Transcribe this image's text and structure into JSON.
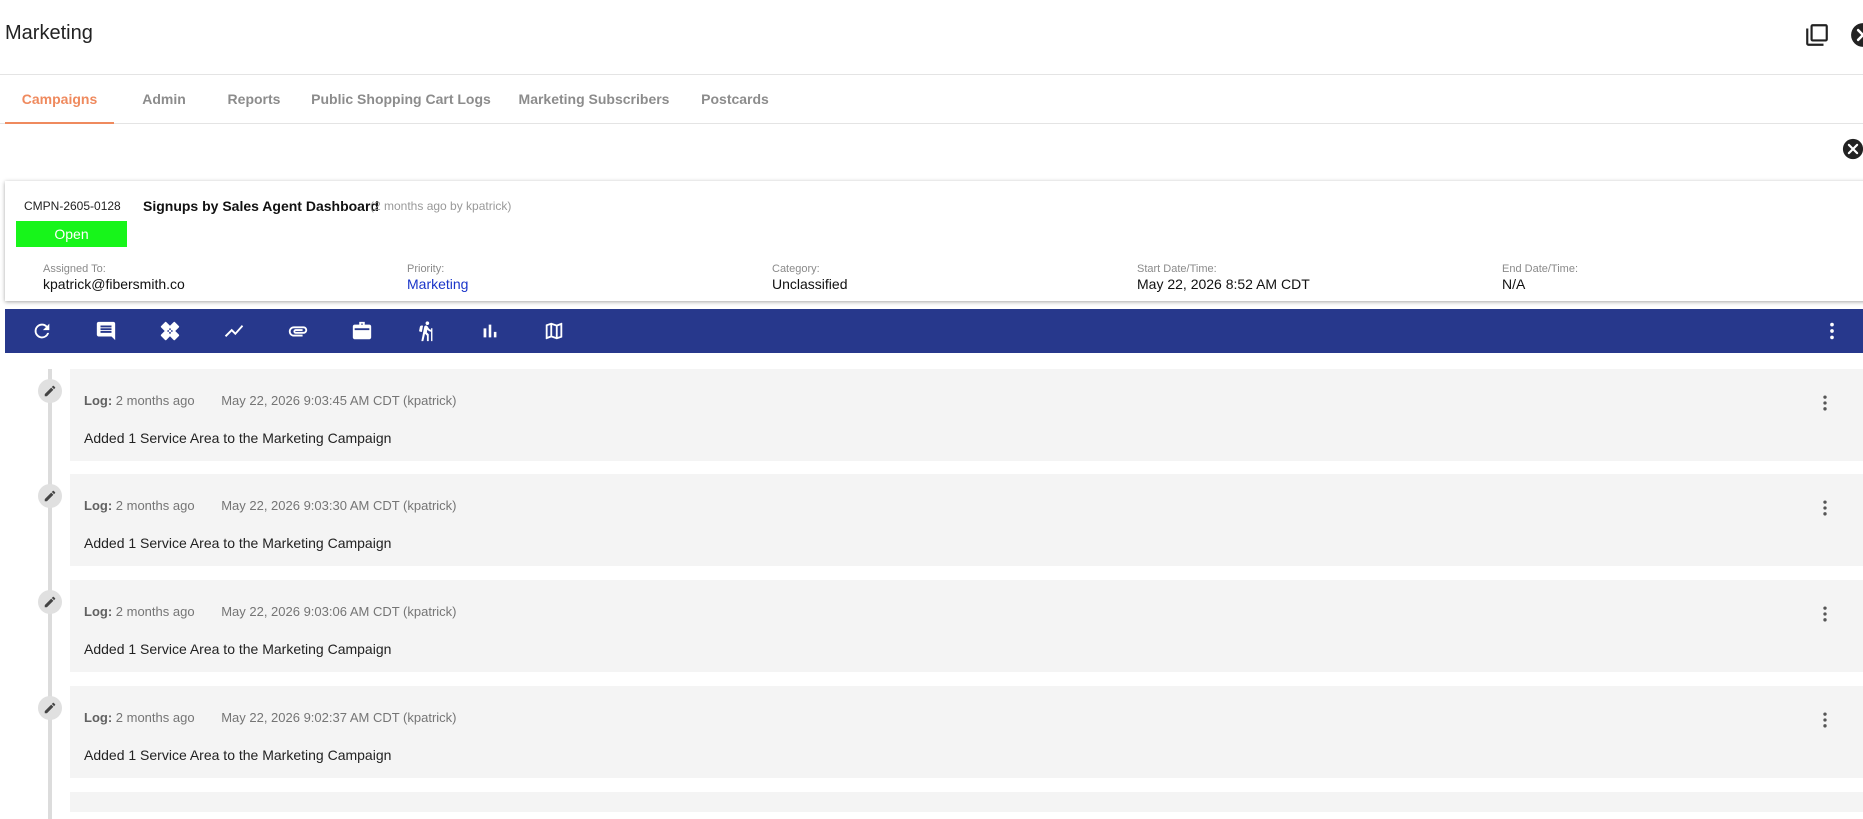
{
  "app": {
    "title": "Marketing"
  },
  "tabs": [
    {
      "label": "Campaigns",
      "active": true
    },
    {
      "label": "Admin"
    },
    {
      "label": "Reports"
    },
    {
      "label": "Public Shopping Cart Logs"
    },
    {
      "label": "Marketing Subscribers"
    },
    {
      "label": "Postcards"
    }
  ],
  "campaign": {
    "id": "CMPN-2605-0128",
    "status": "Open",
    "status_color": "#17f51a",
    "title": "Signups by Sales Agent Dashboard",
    "meta": "(2 months ago by kpatrick)",
    "fields": [
      {
        "label": "Assigned To:",
        "value": "kpatrick@fibersmith.co"
      },
      {
        "label": "Priority:",
        "value": "Marketing"
      },
      {
        "label": "Category:",
        "value": "Unclassified"
      },
      {
        "label": "Start Date/Time:",
        "value": "May 22, 2026 8:52 AM CDT"
      },
      {
        "label": "End Date/Time:",
        "value": "N/A"
      }
    ]
  },
  "toolbar": {
    "color": "#27388c",
    "icons": [
      "refresh-icon",
      "comment-icon",
      "bandage-icon",
      "trend-line-icon",
      "attachment-icon",
      "briefcase-icon",
      "hiker-icon",
      "bar-chart-icon",
      "map-icon",
      "more-vert-icon"
    ]
  },
  "logs": [
    {
      "label": "Log:",
      "age": "2 months ago",
      "date": "May 22, 2026 9:03:45 AM CDT (kpatrick)",
      "text": "Added 1 Service Area to the Marketing Campaign"
    },
    {
      "label": "Log:",
      "age": "2 months ago",
      "date": "May 22, 2026 9:03:30 AM CDT (kpatrick)",
      "text": "Added 1 Service Area to the Marketing Campaign"
    },
    {
      "label": "Log:",
      "age": "2 months ago",
      "date": "May 22, 2026 9:03:06 AM CDT (kpatrick)",
      "text": "Added 1 Service Area to the Marketing Campaign"
    },
    {
      "label": "Log:",
      "age": "2 months ago",
      "date": "May 22, 2026 9:02:37 AM CDT (kpatrick)",
      "text": "Added 1 Service Area to the Marketing Campaign"
    }
  ]
}
